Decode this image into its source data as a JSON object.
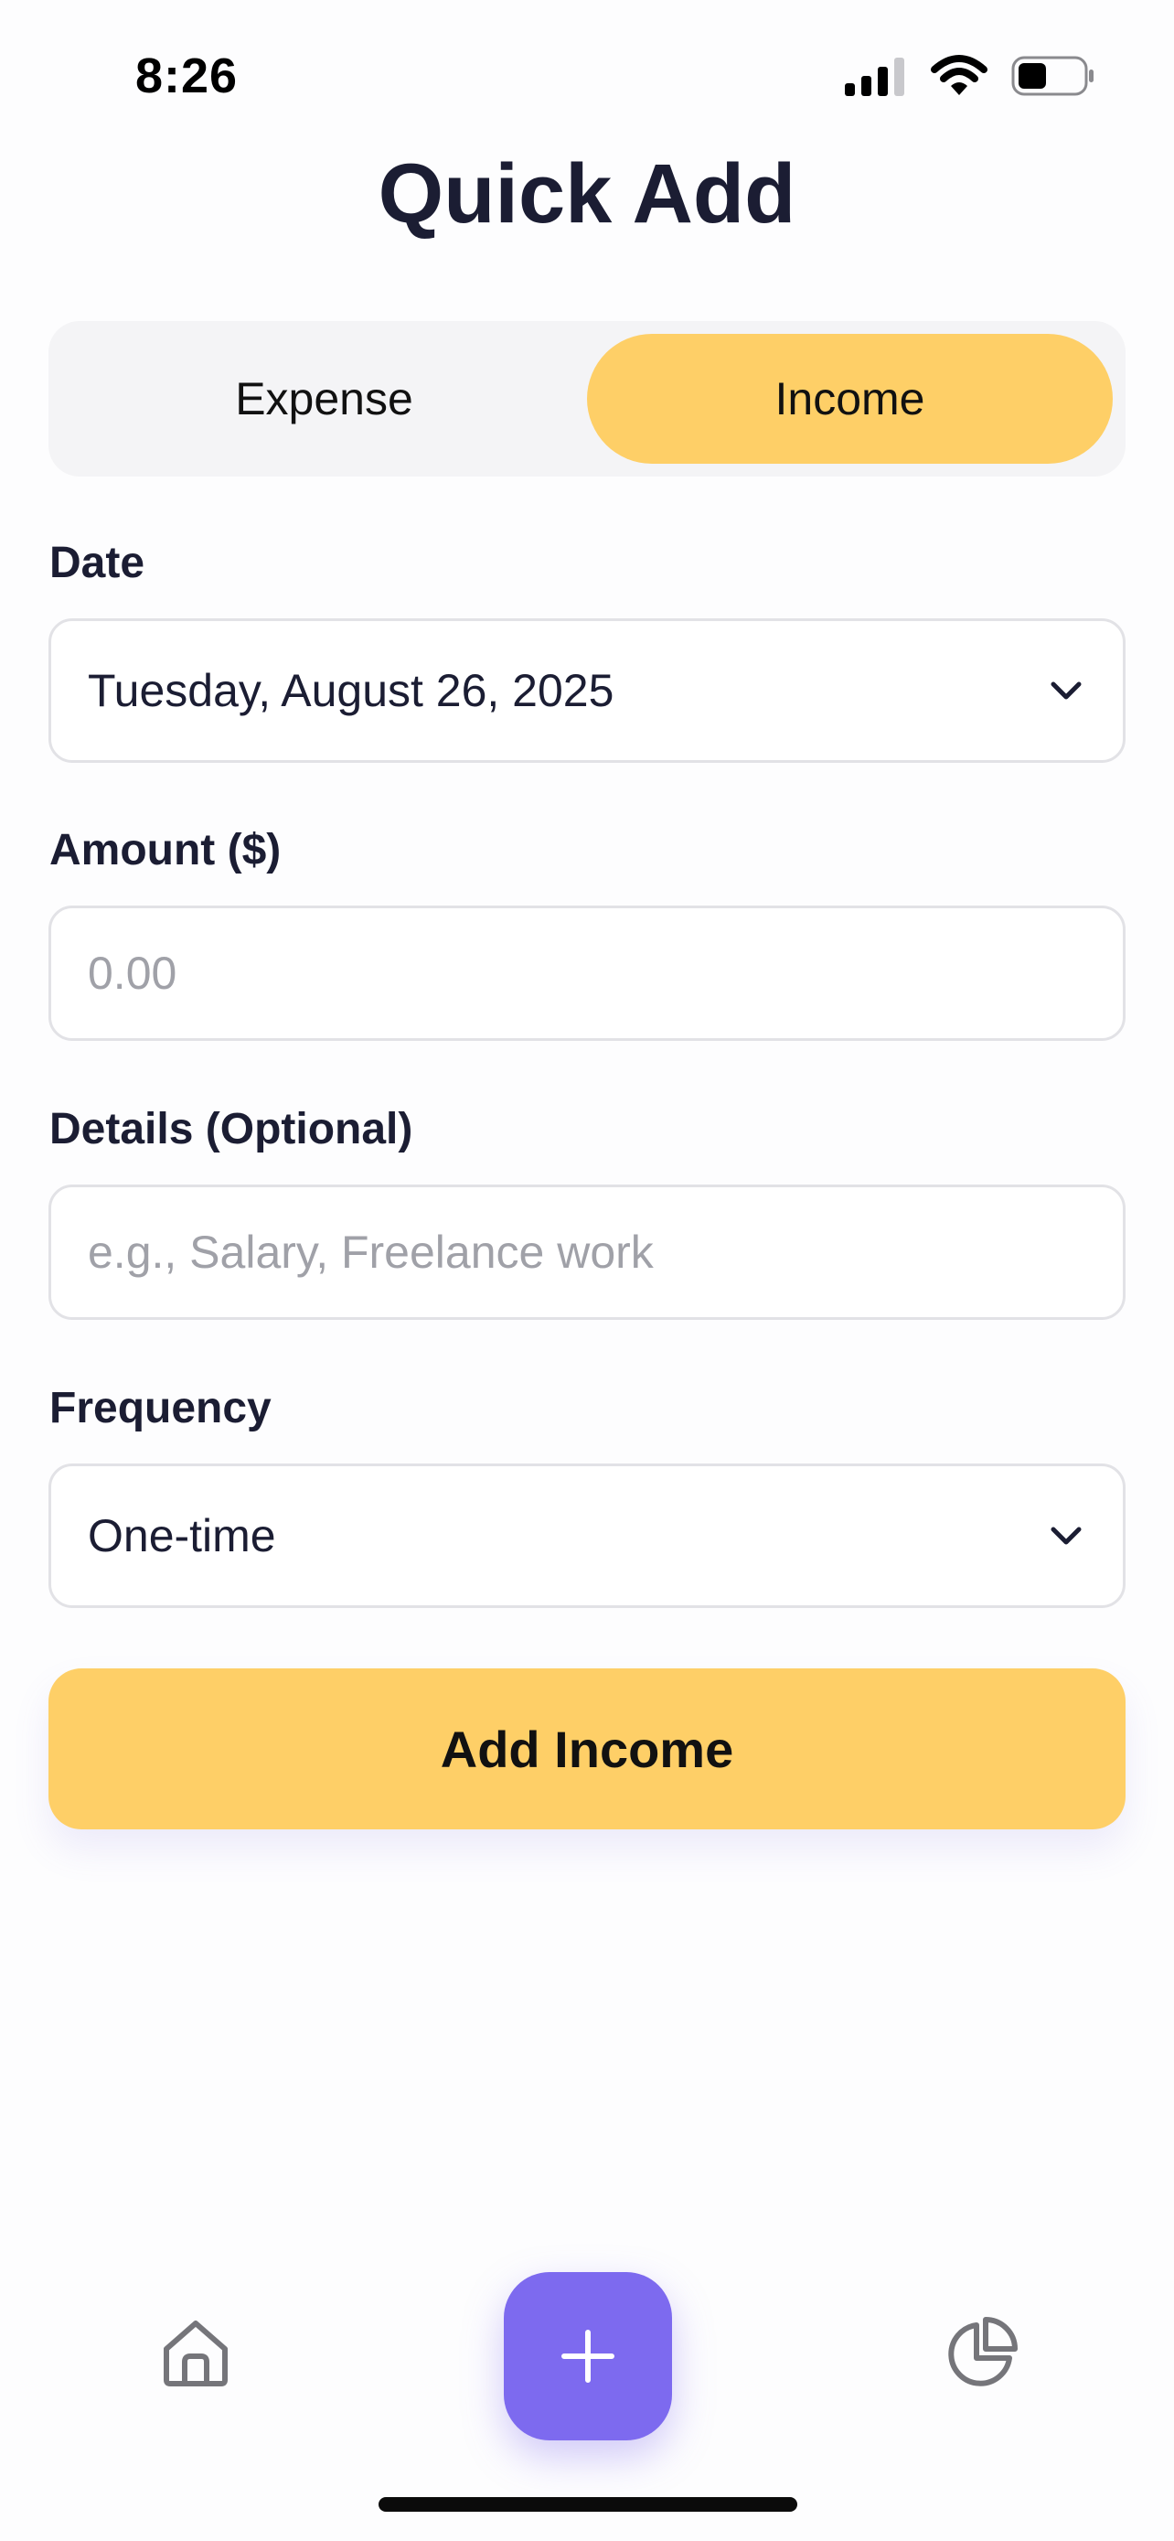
{
  "status_bar": {
    "time": "8:26"
  },
  "page": {
    "title": "Quick Add"
  },
  "type_toggle": {
    "options": [
      "Expense",
      "Income"
    ],
    "selected": "Income"
  },
  "form": {
    "date": {
      "label": "Date",
      "value": "Tuesday, August 26, 2025"
    },
    "amount": {
      "label": "Amount ($)",
      "placeholder": "0.00"
    },
    "details": {
      "label": "Details (Optional)",
      "placeholder": "e.g., Salary, Freelance work"
    },
    "frequency": {
      "label": "Frequency",
      "value": "One-time"
    }
  },
  "submit": {
    "label": "Add Income"
  },
  "tab_bar": {
    "items": [
      {
        "name": "home",
        "icon": "home-icon"
      },
      {
        "name": "add",
        "icon": "plus-icon"
      },
      {
        "name": "reports",
        "icon": "pie-chart-icon"
      }
    ]
  },
  "colors": {
    "accent": "#fecf67",
    "primary": "#7d6aef",
    "text": "#1b1d33",
    "placeholder": "#a0a1a8",
    "border": "#e2e2e6"
  }
}
